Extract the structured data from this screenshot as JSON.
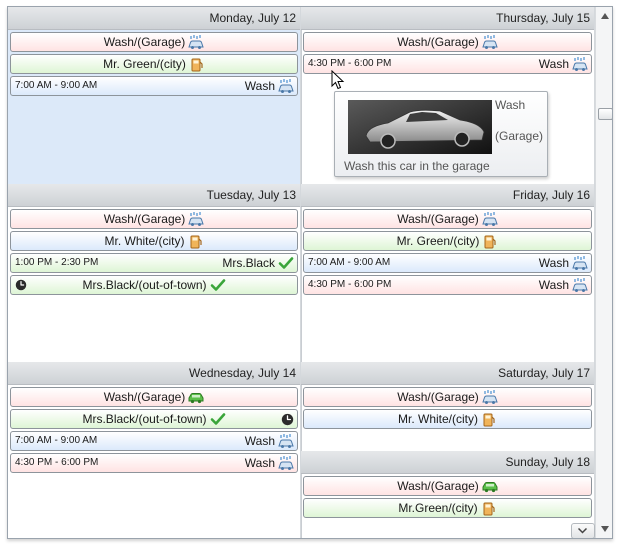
{
  "days": {
    "monday": {
      "header": "Monday, July 12"
    },
    "thursday": {
      "header": "Thursday, July 15"
    },
    "tuesday": {
      "header": "Tuesday, July 13"
    },
    "friday": {
      "header": "Friday, July 16"
    },
    "wednesday": {
      "header": "Wednesday, July 14"
    },
    "saturday": {
      "header": "Saturday, July 17"
    },
    "sunday": {
      "header": "Sunday, July 18"
    }
  },
  "events": {
    "mon": [
      {
        "label": "Wash/(Garage)",
        "icon": "car-wash-icon",
        "color": "pink"
      },
      {
        "label": "Mr. Green/(city)",
        "icon": "fuel-icon",
        "color": "green"
      },
      {
        "time": "7:00 AM - 9:00 AM",
        "label": "Wash",
        "icon": "car-wash-icon",
        "color": "blue"
      }
    ],
    "thu": [
      {
        "label": "Wash/(Garage)",
        "icon": "car-wash-icon",
        "color": "pink"
      },
      {
        "time": "4:30 PM - 6:00 PM",
        "label": "Wash",
        "icon": "car-wash-icon",
        "color": "pink"
      }
    ],
    "tue": [
      {
        "label": "Wash/(Garage)",
        "icon": "car-wash-icon",
        "color": "pink"
      },
      {
        "label": "Mr. White/(city)",
        "icon": "fuel-icon",
        "color": "blue"
      },
      {
        "time": "1:00 PM - 2:30 PM",
        "label": "Mrs.Black",
        "icon": "check-icon",
        "color": "green"
      },
      {
        "label": "Mrs.Black/(out-of-town)",
        "icon": "check-icon",
        "color": "green",
        "recurring": "clock-icon"
      }
    ],
    "fri": [
      {
        "label": "Wash/(Garage)",
        "icon": "car-wash-icon",
        "color": "pink"
      },
      {
        "label": "Mr. Green/(city)",
        "icon": "fuel-icon",
        "color": "green"
      },
      {
        "time": "7:00 AM - 9:00 AM",
        "label": "Wash",
        "icon": "car-wash-icon",
        "color": "blue"
      },
      {
        "time": "4:30 PM - 6:00 PM",
        "label": "Wash",
        "icon": "car-wash-icon",
        "color": "pink"
      }
    ],
    "wed": [
      {
        "label": "Wash/(Garage)",
        "icon": "car-icon",
        "color": "pink"
      },
      {
        "label": "Mrs.Black/(out-of-town)",
        "icon": "check-icon",
        "color": "green",
        "recurring": "clock-icon"
      },
      {
        "time": "7:00 AM - 9:00 AM",
        "label": "Wash",
        "icon": "car-wash-icon",
        "color": "blue"
      },
      {
        "time": "4:30 PM - 6:00 PM",
        "label": "Wash",
        "icon": "car-wash-icon",
        "color": "pink"
      }
    ],
    "sat": [
      {
        "label": "Wash/(Garage)",
        "icon": "car-wash-icon",
        "color": "pink"
      },
      {
        "label": "Mr. White/(city)",
        "icon": "fuel-icon",
        "color": "blue"
      }
    ],
    "sun": [
      {
        "label": "Wash/(Garage)",
        "icon": "car-icon",
        "color": "pink"
      },
      {
        "label": "Mr.Green/(city)",
        "icon": "fuel-icon",
        "color": "green"
      }
    ]
  },
  "tooltip": {
    "title": "Wash",
    "location": "(Garage)",
    "description": "Wash this car in the garage",
    "image": "car-photo"
  },
  "colors": {
    "pink": "#ffe3e3",
    "green": "#def5d5",
    "blue": "#dbe9fb",
    "selected_day": "#dce9f9",
    "header": "#cdd1d5"
  }
}
